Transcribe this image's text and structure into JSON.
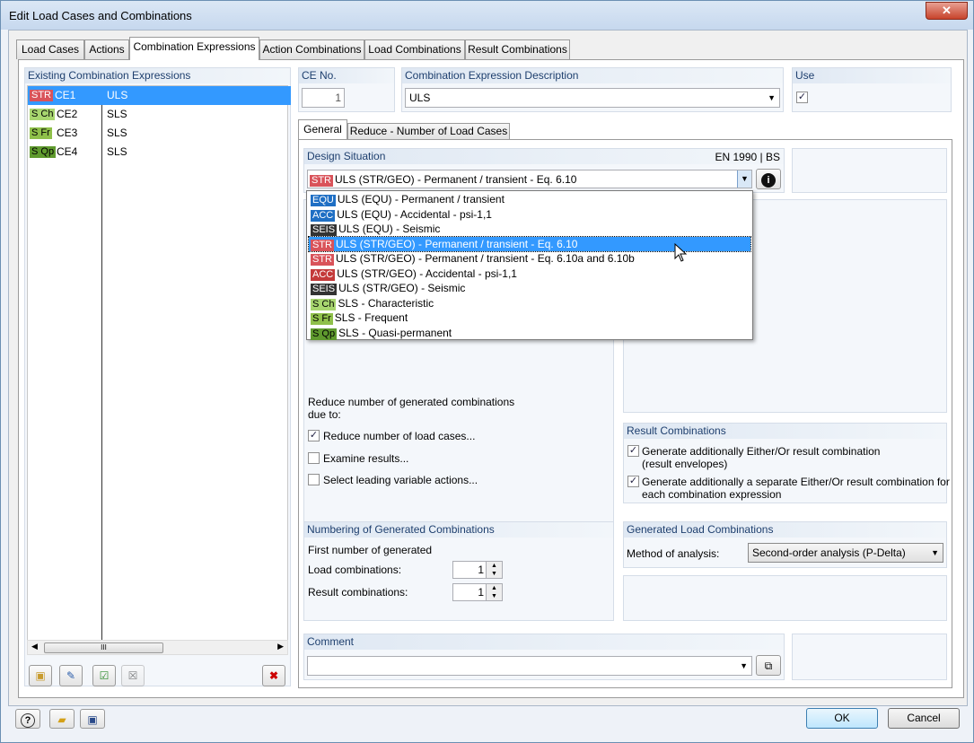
{
  "window": {
    "title": "Edit Load Cases and Combinations",
    "close": "✕"
  },
  "tabs": [
    "Load Cases",
    "Actions",
    "Combination Expressions",
    "Action Combinations",
    "Load Combinations",
    "Result Combinations"
  ],
  "existing": {
    "header": "Existing Combination Expressions",
    "items": [
      {
        "badge": "STR",
        "no": "CE1",
        "desc": "ULS"
      },
      {
        "badge": "S Ch",
        "no": "CE2",
        "desc": "SLS"
      },
      {
        "badge": "S Fr",
        "no": "CE3",
        "desc": "SLS"
      },
      {
        "badge": "S Qp",
        "no": "CE4",
        "desc": "SLS"
      }
    ],
    "scroll_grip": "III"
  },
  "ce_no": {
    "label": "CE No.",
    "value": "1"
  },
  "description": {
    "label": "Combination Expression Description",
    "value": "ULS"
  },
  "use": {
    "label": "Use",
    "checked": "✓"
  },
  "subtabs": [
    "General",
    "Reduce - Number of Load Cases"
  ],
  "design": {
    "label": "Design Situation",
    "standard": "EN 1990 | BS",
    "selected_badge": "STR",
    "selected": "ULS (STR/GEO) - Permanent / transient - Eq. 6.10",
    "info": "i",
    "options": [
      {
        "badge": "EQU",
        "text": "ULS (EQU) - Permanent / transient"
      },
      {
        "badge": "ACC",
        "text": "ULS (EQU) - Accidental - psi-1,1"
      },
      {
        "badge": "SEIS",
        "text": "ULS (EQU) - Seismic"
      },
      {
        "badge": "STR",
        "text": "ULS (STR/GEO) - Permanent / transient - Eq. 6.10"
      },
      {
        "badge": "STR",
        "text": "ULS (STR/GEO) - Permanent / transient - Eq. 6.10a and 6.10b"
      },
      {
        "badge": "ACC",
        "text": "ULS (STR/GEO) - Accidental - psi-1,1"
      },
      {
        "badge": "SEIS",
        "text": "ULS (STR/GEO) - Seismic"
      },
      {
        "badge": "S Ch",
        "text": "SLS - Characteristic"
      },
      {
        "badge": "S Fr",
        "text": "SLS - Frequent"
      },
      {
        "badge": "S Qp",
        "text": "SLS - Quasi-permanent"
      }
    ]
  },
  "reduce": {
    "intro": "Reduce number of generated combinations",
    "intro2": "due to:",
    "opt1": "Reduce number of load cases...",
    "opt2": "Examine results...",
    "opt3": "Select leading variable actions..."
  },
  "result_comb": {
    "header": "Result Combinations",
    "opt1a": "Generate additionally Either/Or result combination",
    "opt1b": "(result envelopes)",
    "opt2a": "Generate additionally a separate Either/Or result combination for",
    "opt2b": "each combination expression"
  },
  "numbering": {
    "header": "Numbering of Generated Combinations",
    "first": "First number of generated",
    "load_label": "Load combinations:",
    "load_value": "1",
    "result_label": "Result combinations:",
    "result_value": "1"
  },
  "generated": {
    "header": "Generated Load Combinations",
    "method_label": "Method of analysis:",
    "method_value": "Second-order analysis (P-Delta)"
  },
  "comment": {
    "label": "Comment",
    "value": ""
  },
  "buttons": {
    "ok": "OK",
    "cancel": "Cancel"
  }
}
